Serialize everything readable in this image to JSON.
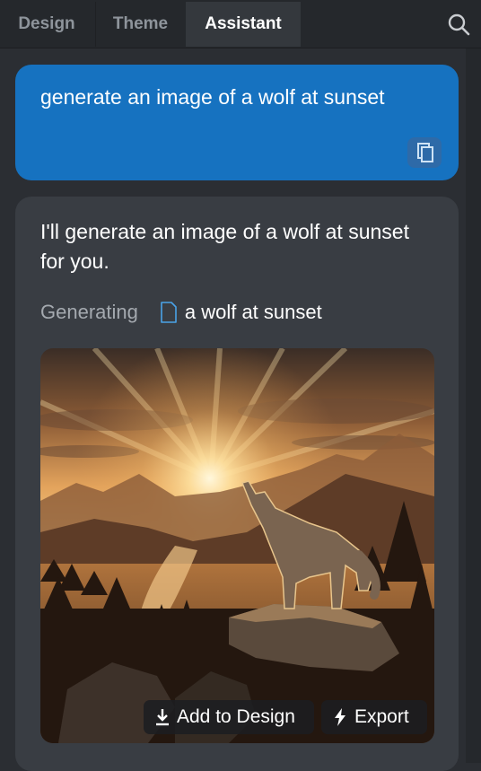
{
  "tabs": [
    {
      "label": "Design",
      "active": false
    },
    {
      "label": "Theme",
      "active": false
    },
    {
      "label": "Assistant",
      "active": true
    }
  ],
  "header": {
    "search_icon": "search-icon"
  },
  "chat": {
    "user_message": "generate an image of a wolf at sunset",
    "assistant_message": "I'll generate an image of a wolf at sunset for you.",
    "generating_label": "Generating",
    "generating_target": "a wolf at sunset",
    "image_subject": "wolf howling on a rock at sunset over mountains",
    "add_to_design_label": "Add to Design",
    "export_label": "Export"
  },
  "colors": {
    "background": "#2b2e33",
    "user_bubble": "#1672c0",
    "assistant_card": "#393d43",
    "accent_icon": "#4aa3e8"
  }
}
